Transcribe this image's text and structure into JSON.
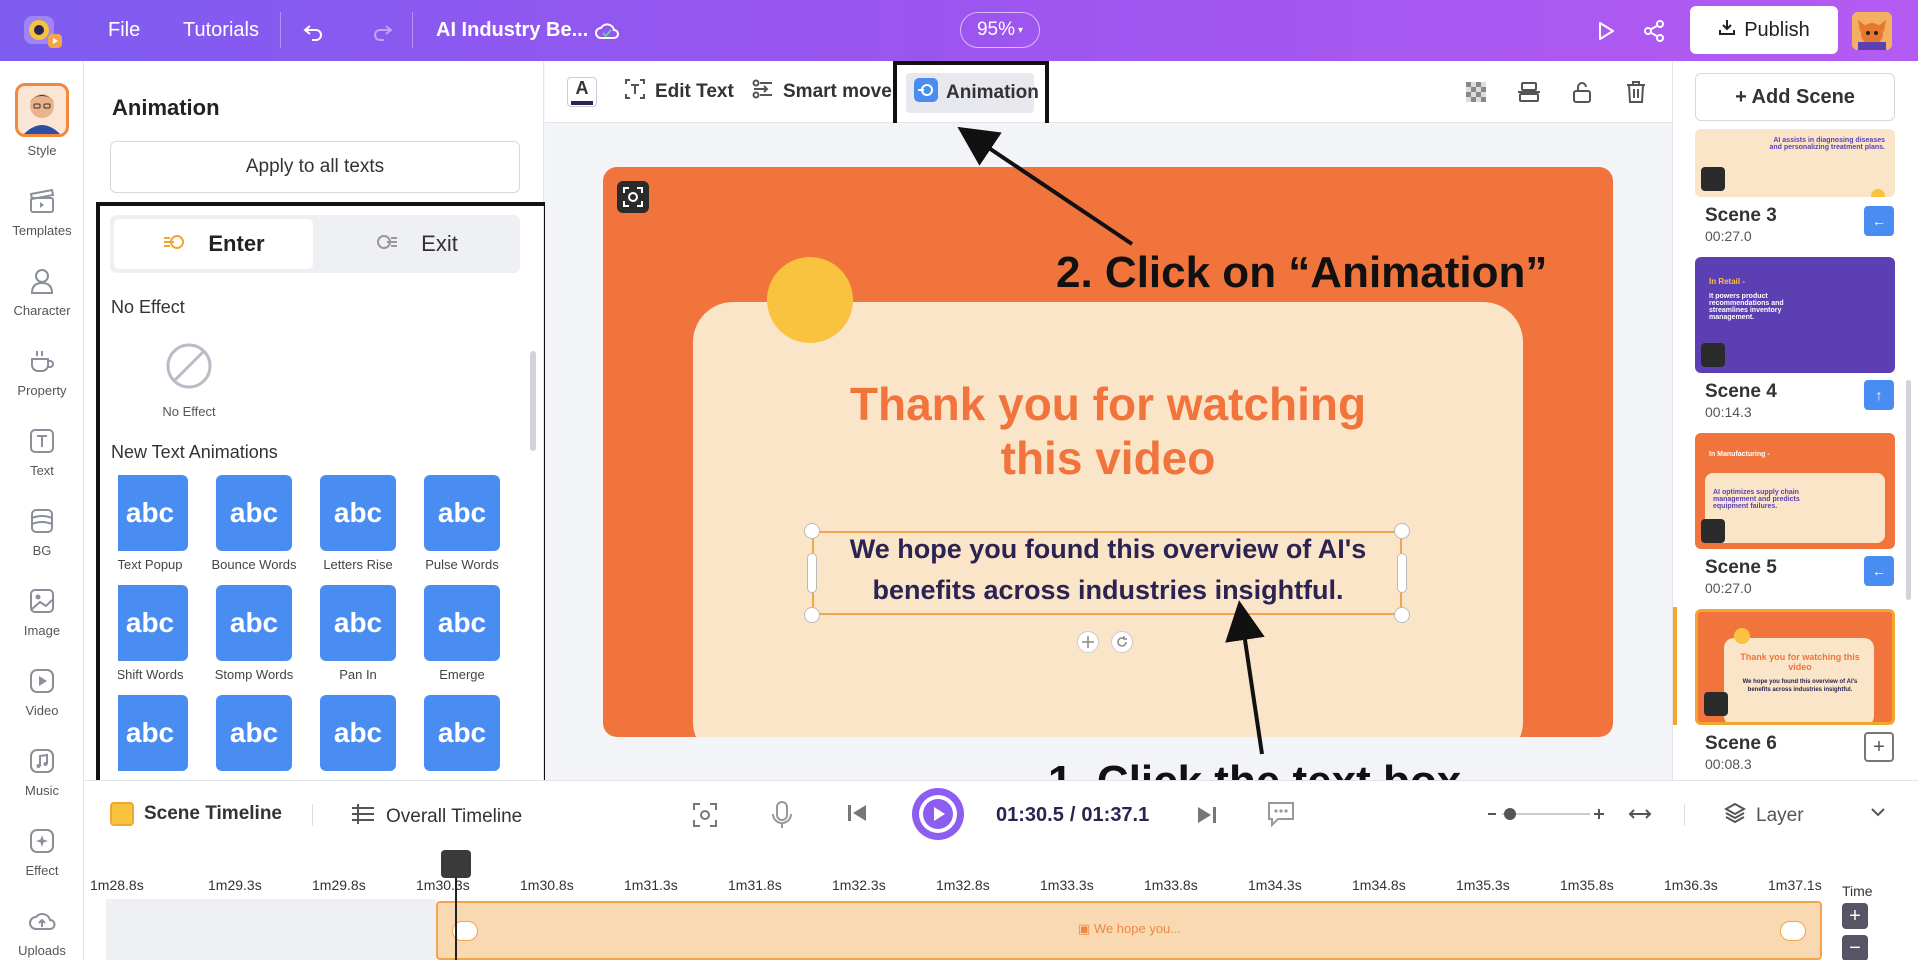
{
  "topbar": {
    "file": "File",
    "tutorials": "Tutorials",
    "project_title": "AI Industry Be...",
    "zoom": "95%",
    "publish": "Publish"
  },
  "rail": {
    "items": [
      {
        "label": "Style"
      },
      {
        "label": "Templates"
      },
      {
        "label": "Character"
      },
      {
        "label": "Property"
      },
      {
        "label": "Text"
      },
      {
        "label": "BG"
      },
      {
        "label": "Image"
      },
      {
        "label": "Video"
      },
      {
        "label": "Music"
      },
      {
        "label": "Effect"
      },
      {
        "label": "Uploads"
      }
    ]
  },
  "panel": {
    "title": "Animation",
    "apply_all": "Apply to all texts",
    "tab_enter": "Enter",
    "tab_exit": "Exit",
    "no_effect_section": "No Effect",
    "no_effect_item": "No Effect",
    "new_anim_section": "New Text Animations",
    "animations": [
      {
        "label": "Text Popup",
        "glyph": "abc"
      },
      {
        "label": "Bounce Words",
        "glyph": "abc"
      },
      {
        "label": "Letters Rise",
        "glyph": "abc"
      },
      {
        "label": "Pulse Words",
        "glyph": "abc"
      },
      {
        "label": "Shift Words",
        "glyph": "abc"
      },
      {
        "label": "Stomp Words",
        "glyph": "abc"
      },
      {
        "label": "Pan In",
        "glyph": "abc"
      },
      {
        "label": "Emerge",
        "glyph": "abc"
      },
      {
        "label": "",
        "glyph": "abc"
      },
      {
        "label": "",
        "glyph": "abc"
      },
      {
        "label": "",
        "glyph": "abc"
      },
      {
        "label": "",
        "glyph": "abc"
      }
    ]
  },
  "editor_toolbar": {
    "text_color": "A",
    "edit_text": "Edit Text",
    "smart_move": "Smart move",
    "animation": "Animation"
  },
  "slide": {
    "title_line1": "Thank you for watching",
    "title_line2": "this video",
    "body_line1": "We hope you found this overview of AI's",
    "body_line2": "benefits across industries insightful."
  },
  "annotations": {
    "step2": "2. Click on “Animation”",
    "step1": "1. Click the text box"
  },
  "scenes": {
    "add_scene": "+ Add Scene",
    "thumb_text_top": "AI assists in diagnosing diseases and personalizing treatment plans.",
    "list": [
      {
        "label": "Scene 3",
        "time": "00:27.0",
        "thumb_title": "",
        "thumb_text": ""
      },
      {
        "label": "Scene 4",
        "time": "00:14.3",
        "thumb_title": "In Retail -",
        "thumb_text": "It powers product recommendations and streamlines inventory management."
      },
      {
        "label": "Scene 5",
        "time": "00:27.0",
        "thumb_title": "In Manufacturing -",
        "thumb_text": "AI optimizes supply chain management and predicts equipment failures."
      },
      {
        "label": "Scene 6",
        "time": "00:08.3",
        "thumb_title": "Thank you for watching this video",
        "thumb_text": "We hope you found this overview of AI's benefits across industries insightful."
      }
    ]
  },
  "timeline": {
    "scene_timeline": "Scene Timeline",
    "overall_timeline": "Overall Timeline",
    "current_time": "01:30.5",
    "separator": "/",
    "total_time": "01:37.1",
    "layer": "Layer",
    "time_label": "Time",
    "track_label": "We hope you...",
    "ticks": [
      "1m28.8s",
      "1m29.3s",
      "1m29.8s",
      "1m30.3s",
      "1m30.8s",
      "1m31.3s",
      "1m31.8s",
      "1m32.3s",
      "1m32.8s",
      "1m33.3s",
      "1m33.8s",
      "1m34.3s",
      "1m34.8s",
      "1m35.3s",
      "1m35.8s",
      "1m36.3s",
      "1m37.1s"
    ]
  },
  "colors": {
    "accent": "#8d5cf0",
    "slide_bg": "#f0743c",
    "slide_card": "#fae5c8",
    "tile_blue": "#4a8df2"
  }
}
